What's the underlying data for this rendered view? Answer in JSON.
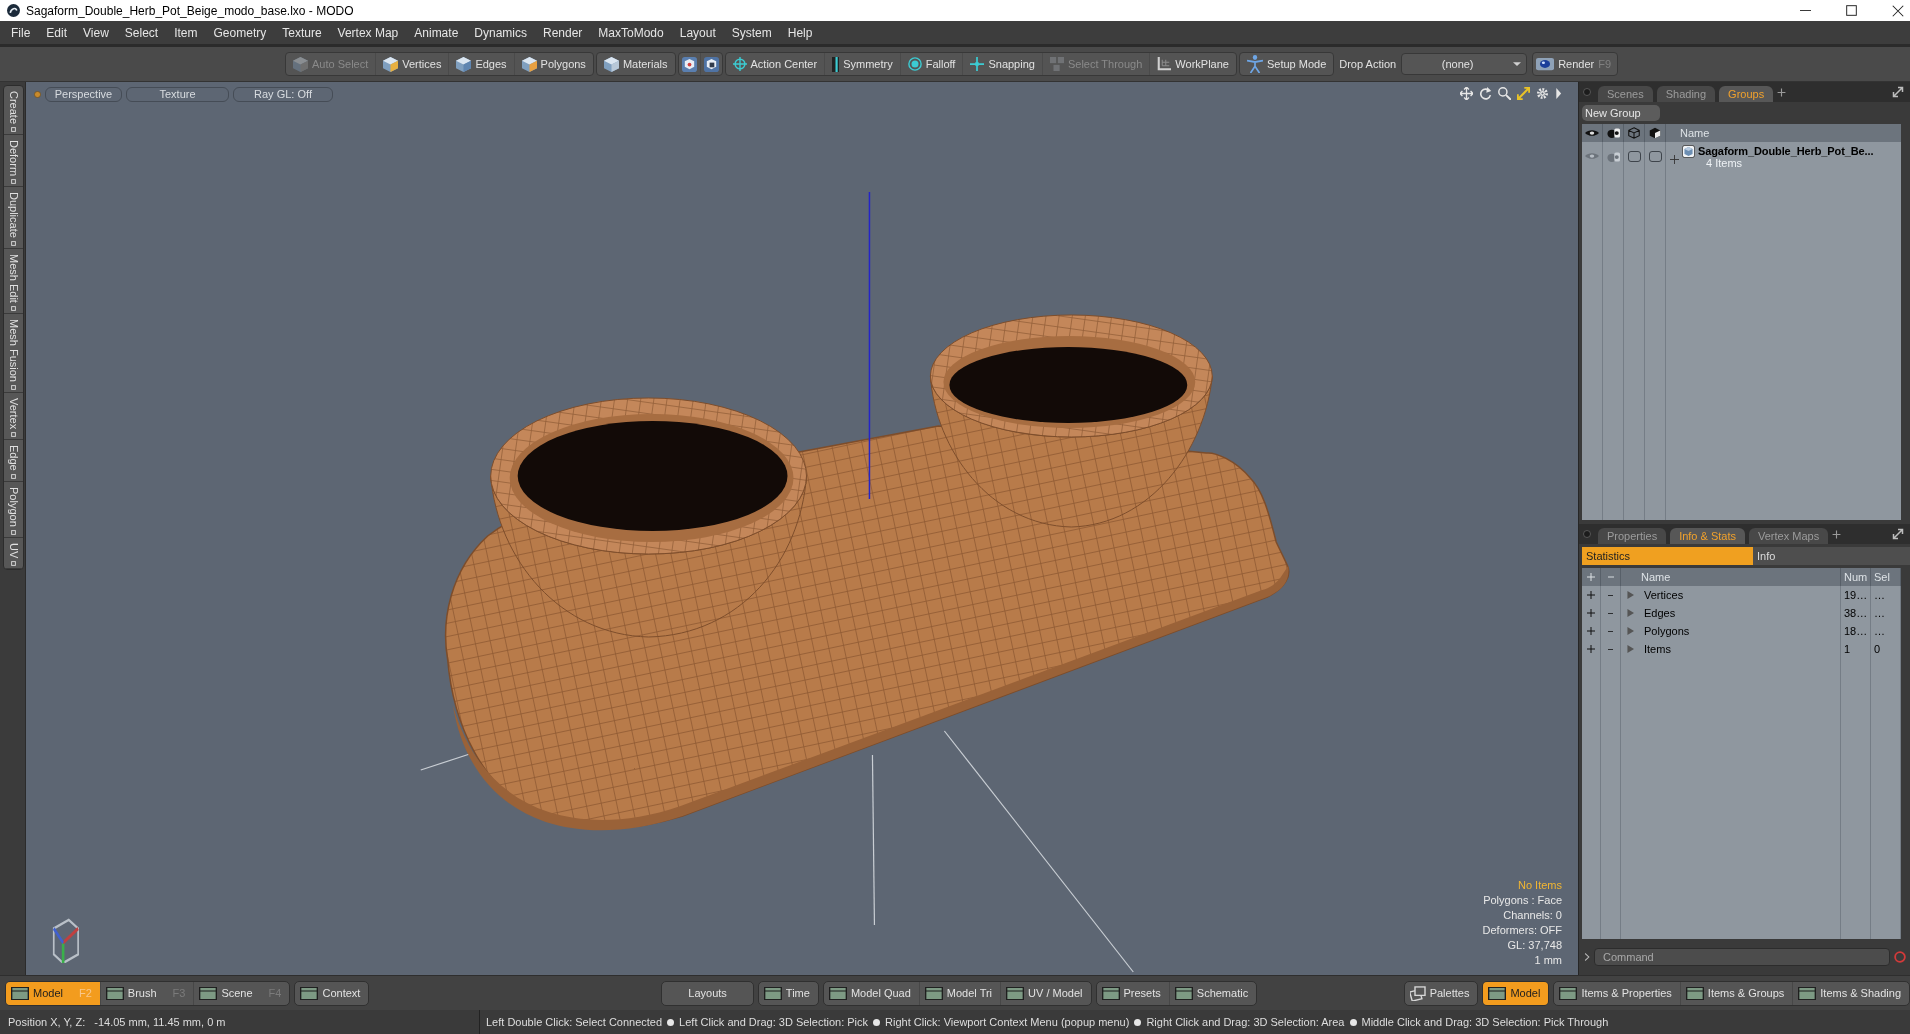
{
  "window": {
    "title": "Sagaform_Double_Herb_Pot_Beige_modo_base.lxo - MODO"
  },
  "menu_bar": [
    "File",
    "Edit",
    "View",
    "Select",
    "Item",
    "Geometry",
    "Texture",
    "Vertex Map",
    "Animate",
    "Dynamics",
    "Render",
    "MaxToModo",
    "Layout",
    "System",
    "Help"
  ],
  "toolbar": {
    "groups": [
      {
        "items": [
          {
            "kind": "labeled",
            "label": "Auto Select",
            "disabled": true
          },
          {
            "kind": "labeled",
            "label": "Vertices",
            "disabled": false
          },
          {
            "kind": "labeled",
            "label": "Edges",
            "disabled": false
          },
          {
            "kind": "labeled",
            "label": "Polygons",
            "disabled": false
          }
        ]
      },
      {
        "items": [
          {
            "kind": "labeled",
            "label": "Materials",
            "disabled": false
          }
        ]
      },
      {
        "items": [
          {
            "kind": "icon_only",
            "disabled": false
          },
          {
            "kind": "icon_only",
            "disabled": false
          }
        ]
      },
      {
        "items": [
          {
            "kind": "labeled",
            "label": "Action Center",
            "disabled": false
          },
          {
            "kind": "labeled",
            "label": "Symmetry",
            "disabled": false
          },
          {
            "kind": "labeled",
            "label": "Falloff",
            "disabled": false
          },
          {
            "kind": "labeled",
            "label": "Snapping",
            "disabled": false
          },
          {
            "kind": "labeled",
            "label": "Select Through",
            "disabled": true
          },
          {
            "kind": "labeled",
            "label": "WorkPlane",
            "disabled": false
          }
        ]
      },
      {
        "items": [
          {
            "kind": "labeled",
            "label": "Setup Mode",
            "disabled": false
          }
        ]
      }
    ],
    "drop_action": {
      "label": "Drop Action",
      "value": "(none)"
    },
    "render_button": {
      "label": "Render",
      "shortcut": "F9"
    }
  },
  "side_tabs": [
    "Create",
    "Deform",
    "Duplicate",
    "Mesh Edit",
    "Mesh Fusion",
    "Vertex",
    "Edge",
    "Polygon",
    "UV"
  ],
  "viewport": {
    "view_buttons": [
      "Perspective",
      "Texture",
      "Ray GL: Off"
    ],
    "info": [
      {
        "kind": "notice",
        "text": "No Items"
      },
      {
        "kind": "plain",
        "text": "Polygons : Face"
      },
      {
        "kind": "plain",
        "text": "Channels: 0"
      },
      {
        "kind": "plain",
        "text": "Deformers: OFF"
      },
      {
        "kind": "plain",
        "text": "GL: 37,748"
      },
      {
        "kind": "plain",
        "text": "1 mm"
      }
    ]
  },
  "scene_panel": {
    "tabs": [
      {
        "label": "Scenes",
        "selected": false
      },
      {
        "label": "Shading",
        "selected": false
      },
      {
        "label": "Groups",
        "selected": true
      }
    ],
    "new_group_button": "New Group",
    "name_column": "Name",
    "items": [
      {
        "name": "Sagaform_Double_Herb_Pot_Be...",
        "count": "4 Items",
        "expanded": false
      }
    ]
  },
  "stats_panel": {
    "tabs": [
      {
        "label": "Properties",
        "selected": false
      },
      {
        "label": "Info & Stats",
        "selected": true
      },
      {
        "label": "Vertex Maps",
        "selected": false
      }
    ],
    "subtabs": [
      {
        "label": "Statistics",
        "selected": true
      },
      {
        "label": "Info",
        "selected": false
      }
    ],
    "columns": [
      "Name",
      "Num",
      "Sel"
    ],
    "rows": [
      {
        "name": "Vertices",
        "num": "19…",
        "sel": "…",
        "expanded": false
      },
      {
        "name": "Edges",
        "num": "38…",
        "sel": "…",
        "expanded": false
      },
      {
        "name": "Polygons",
        "num": "18…",
        "sel": "…",
        "expanded": false
      },
      {
        "name": "Items",
        "num": "1",
        "sel": "0",
        "expanded": false
      }
    ]
  },
  "command_field": {
    "placeholder": "Command"
  },
  "bottom_toolbar": {
    "left": [
      {
        "buttons": [
          {
            "label": "Model",
            "shortcut": "F2",
            "selected": true
          },
          {
            "label": "Brush",
            "shortcut": "F3",
            "selected": false
          },
          {
            "label": "Scene",
            "shortcut": "F4",
            "selected": false
          }
        ]
      },
      {
        "buttons": [
          {
            "label": "Context",
            "selected": false
          }
        ]
      }
    ],
    "center": [
      {
        "buttons": [
          {
            "label": "Layouts"
          }
        ]
      },
      {
        "buttons": [
          {
            "label": "Time"
          }
        ]
      },
      {
        "buttons": [
          {
            "label": "Model Quad"
          },
          {
            "label": "Model Tri"
          },
          {
            "label": "UV / Model"
          }
        ]
      },
      {
        "buttons": [
          {
            "label": "Presets"
          },
          {
            "label": "Schematic"
          }
        ]
      }
    ],
    "right": [
      {
        "buttons": [
          {
            "label": "Palettes",
            "selected": false
          }
        ]
      },
      {
        "buttons": [
          {
            "label": "Model",
            "selected": true
          }
        ]
      },
      {
        "buttons": [
          {
            "label": "Items & Properties",
            "selected": false
          },
          {
            "label": "Items & Groups",
            "selected": false
          },
          {
            "label": "Items & Shading",
            "selected": false
          }
        ]
      }
    ]
  },
  "status_bar": {
    "position_label": "Position X, Y, Z:",
    "position_value": "-14.05 mm, 11.45 mm, 0 m",
    "hints": [
      "Left Double Click: Select Connected",
      "Left Click and Drag: 3D Selection: Pick",
      "Right Click: Viewport Context Menu (popup menu)",
      "Right Click and Drag: 3D Selection: Area",
      "Middle Click and Drag: 3D Selection: Pick Through"
    ]
  }
}
